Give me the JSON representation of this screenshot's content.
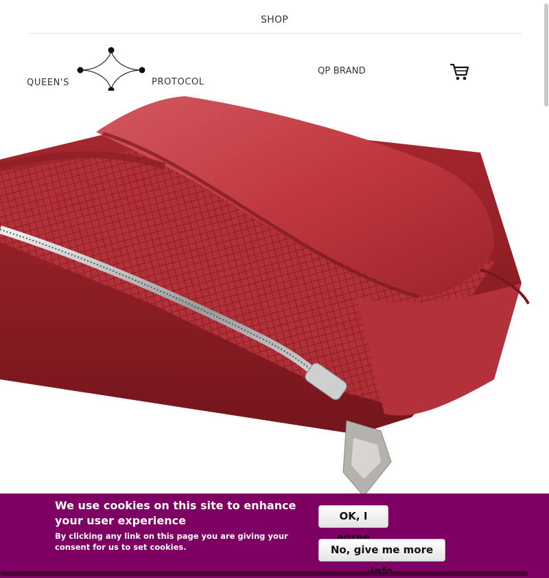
{
  "nav": {
    "shop_label": "SHOP"
  },
  "header": {
    "logo_left": "QUEEN'S",
    "logo_right": "PROTOCOL",
    "brand_link": "QP BRAND",
    "cart_icon": "shopping-cart-icon"
  },
  "hero": {
    "image_icon": "red-leather-clutch-photo"
  },
  "cookie_banner": {
    "title": "We use cookies on this site to enhance your user experience",
    "text": "By clicking any link on this page you are giving your consent for us to set cookies.",
    "agree_label": "OK, I agree",
    "more_info_label": "No, give me more info",
    "background_color": "#7e0062"
  },
  "colors": {
    "text": "#333333",
    "accent": "#7e0062",
    "product_red": "#b8323a"
  }
}
